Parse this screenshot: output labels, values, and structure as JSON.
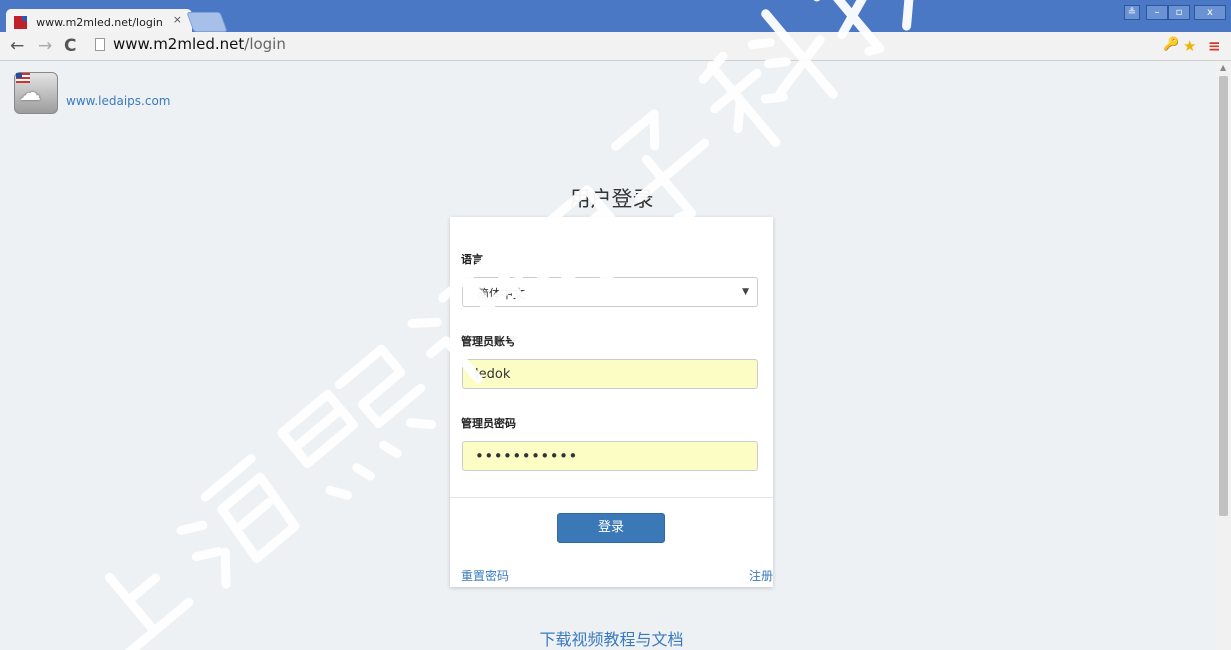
{
  "browser": {
    "tab_title": "www.m2mled.net/login",
    "tab_close": "×",
    "url_host": "www.m2mled.net",
    "url_path": "/login",
    "window_controls": [
      "≗",
      "–",
      "▫",
      "x"
    ]
  },
  "page": {
    "site_link": "www.ledaips.com",
    "login_title": "用户登录",
    "language_label": "语言",
    "language_value": "简体中文",
    "account_label": "管理员账号",
    "account_value": "ledok",
    "password_label": "管理员密码",
    "password_value": "•••••••••••",
    "login_button": "登录",
    "reset_password": "重置密码",
    "register": "注册",
    "download_link": "下载视频教程与文档"
  },
  "watermark": "上海熙讯电子科技",
  "colors": {
    "tab_bar": "#4a78c5",
    "page_bg": "#eef1f4",
    "accent": "#3a78b8",
    "autofill": "#fbfdc5"
  }
}
